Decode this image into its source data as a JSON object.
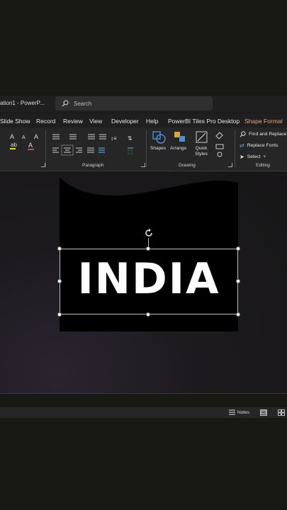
{
  "titlebar": {
    "doc_title": "ation1  -  PowerP...",
    "search_placeholder": "Search"
  },
  "tabs": [
    {
      "label": "Slide Show"
    },
    {
      "label": "Record"
    },
    {
      "label": "Review"
    },
    {
      "label": "View"
    },
    {
      "label": "Developer"
    },
    {
      "label": "Help"
    },
    {
      "label": "PowerBI Tiles Pro Desktop"
    },
    {
      "label": "Shape Format"
    }
  ],
  "ribbon": {
    "paragraph_label": "Paragraph",
    "drawing_label": "Drawing",
    "editing_label": "Editing",
    "shapes_label": "Shapes",
    "arrange_label": "Arrange",
    "quick_styles_label": "Quick Styles",
    "find_replace_label": "Find and Replace",
    "replace_fonts_label": "Replace Fonts",
    "select_label": "Select"
  },
  "slide": {
    "text": "INDIA"
  },
  "statusbar": {
    "notes_label": "Notes"
  },
  "colors": {
    "accent_tab": "#f0a37a",
    "ribbon_bg": "#262626",
    "slide_bg": "#000000"
  }
}
